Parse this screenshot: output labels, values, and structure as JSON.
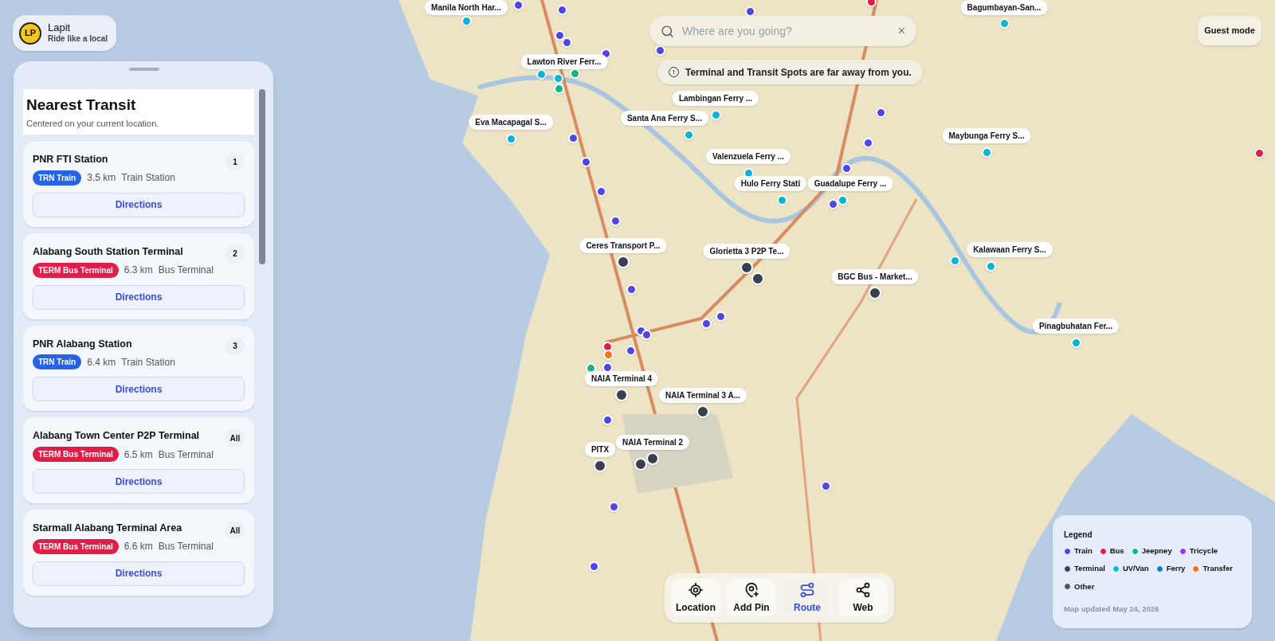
{
  "brand": {
    "initials": "LP",
    "name": "Lapit",
    "tagline": "Ride like a local"
  },
  "search": {
    "placeholder": "Where are you going?",
    "clear": "×"
  },
  "notice": {
    "icon": "!",
    "text": "Terminal and Transit Spots are far away from you."
  },
  "guest_button": "Guest mode",
  "panel": {
    "title": "Nearest Transit",
    "subtitle": "Centered on your current location.",
    "results": [
      {
        "name": "PNR FTI Station",
        "badge": {
          "kind": "train",
          "text": "TRN Train"
        },
        "distance": "3.5 km",
        "type": "Train Station",
        "rank": "1",
        "action": "Directions"
      },
      {
        "name": "Alabang South Station Terminal",
        "badge": {
          "kind": "terminal",
          "text": "TERM Bus Terminal"
        },
        "distance": "6.3 km",
        "type": "Bus Terminal",
        "rank": "2",
        "action": "Directions"
      },
      {
        "name": "PNR Alabang Station",
        "badge": {
          "kind": "train",
          "text": "TRN Train"
        },
        "distance": "6.4 km",
        "type": "Train Station",
        "rank": "3",
        "action": "Directions"
      },
      {
        "name": "Alabang Town Center P2P Terminal",
        "badge": {
          "kind": "terminal",
          "text": "TERM Bus Terminal"
        },
        "distance": "6.5 km",
        "type": "Bus Terminal",
        "rank": "All",
        "action": "Directions"
      },
      {
        "name": "Starmall Alabang Terminal Area",
        "badge": {
          "kind": "terminal",
          "text": "TERM Bus Terminal"
        },
        "distance": "6.6 km",
        "type": "Bus Terminal",
        "rank": "All",
        "action": "Directions"
      }
    ]
  },
  "markers": [
    {
      "kind": "ferry",
      "color": "#06b6d4",
      "label": "Manila North Har..."
    },
    {
      "kind": "ferry",
      "color": "#06b6d4",
      "label": "Lawton River Ferr..."
    },
    {
      "kind": "ferry",
      "color": "#06b6d4",
      "label": "Eva Macapagal S..."
    },
    {
      "kind": "ferry",
      "color": "#06b6d4",
      "label": "Lambingan Ferry ..."
    },
    {
      "kind": "ferry",
      "color": "#06b6d4",
      "label": "Santa Ana Ferry S..."
    },
    {
      "kind": "ferry",
      "color": "#06b6d4",
      "label": "Valenzuela Ferry ..."
    },
    {
      "kind": "ferry",
      "color": "#06b6d4",
      "label": "Hulo Ferry Stati"
    },
    {
      "kind": "ferry",
      "color": "#06b6d4",
      "label": "Guadalupe Ferry ..."
    },
    {
      "kind": "ferry",
      "color": "#06b6d4",
      "label": "Bagumbayan-San..."
    },
    {
      "kind": "ferry",
      "color": "#06b6d4",
      "label": "Maybunga Ferry S..."
    },
    {
      "kind": "ferry",
      "color": "#06b6d4",
      "label": "Kalawaan Ferry S..."
    },
    {
      "kind": "ferry",
      "color": "#06b6d4",
      "label": "Pinagbuhatan Fer..."
    },
    {
      "kind": "terminal",
      "color": "#374151",
      "label": "Ceres Transport P..."
    },
    {
      "kind": "terminal",
      "color": "#374151",
      "label": "Glorietta 3 P2P Te..."
    },
    {
      "kind": "terminal",
      "color": "#374151",
      "label": "BGC Bus - Market..."
    },
    {
      "kind": "terminal",
      "color": "#374151",
      "label": "NAIA Terminal 4"
    },
    {
      "kind": "terminal",
      "color": "#374151",
      "label": "NAIA Terminal 3 A..."
    },
    {
      "kind": "terminal",
      "color": "#374151",
      "label": "NAIA Terminal 2"
    },
    {
      "kind": "terminal",
      "color": "#374151",
      "label": "PITX"
    },
    {
      "kind": "terminal",
      "color": "#374151"
    },
    {
      "kind": "terminal",
      "color": "#374151"
    },
    {
      "kind": "ferry",
      "color": "#06b6d4"
    },
    {
      "kind": "ferry",
      "color": "#06b6d4"
    },
    {
      "kind": "train",
      "color": "#4f46e5"
    },
    {
      "kind": "train",
      "color": "#4f46e5"
    },
    {
      "kind": "train",
      "color": "#4f46e5"
    },
    {
      "kind": "train",
      "color": "#4f46e5"
    },
    {
      "kind": "train",
      "color": "#4f46e5"
    },
    {
      "kind": "train",
      "color": "#4f46e5"
    },
    {
      "kind": "train",
      "color": "#4f46e5"
    },
    {
      "kind": "train",
      "color": "#4f46e5"
    },
    {
      "kind": "train",
      "color": "#4f46e5"
    },
    {
      "kind": "train",
      "color": "#4f46e5"
    },
    {
      "kind": "train",
      "color": "#4f46e5"
    },
    {
      "kind": "train",
      "color": "#4f46e5"
    },
    {
      "kind": "train",
      "color": "#4f46e5"
    },
    {
      "kind": "train",
      "color": "#4f46e5"
    },
    {
      "kind": "train",
      "color": "#4f46e5"
    },
    {
      "kind": "train",
      "color": "#4f46e5"
    },
    {
      "kind": "train",
      "color": "#4f46e5"
    },
    {
      "kind": "train",
      "color": "#4f46e5"
    },
    {
      "kind": "train",
      "color": "#4f46e5"
    },
    {
      "kind": "train",
      "color": "#4f46e5"
    },
    {
      "kind": "train",
      "color": "#4f46e5"
    },
    {
      "kind": "train",
      "color": "#4f46e5"
    },
    {
      "kind": "train",
      "color": "#4f46e5"
    },
    {
      "kind": "train",
      "color": "#4f46e5"
    },
    {
      "kind": "train",
      "color": "#4f46e5"
    },
    {
      "kind": "train",
      "color": "#4f46e5"
    },
    {
      "kind": "bus",
      "color": "#e11d48"
    },
    {
      "kind": "bus",
      "color": "#e11d48"
    },
    {
      "kind": "bus",
      "color": "#e11d48"
    },
    {
      "kind": "jeepney",
      "color": "#10b981"
    },
    {
      "kind": "jeepney",
      "color": "#10b981"
    },
    {
      "kind": "jeepney",
      "color": "#10b981"
    },
    {
      "kind": "transfer",
      "color": "#f97316"
    }
  ],
  "toolbar": [
    {
      "kind": "location",
      "label": "Location",
      "selected": false
    },
    {
      "kind": "pin",
      "label": "Add Pin",
      "selected": false
    },
    {
      "kind": "route",
      "label": "Route",
      "selected": true
    },
    {
      "kind": "web",
      "label": "Web",
      "selected": false
    }
  ],
  "legend": {
    "title": "Legend",
    "items": [
      {
        "label": "Train",
        "color": "#4f46e5"
      },
      {
        "label": "Bus",
        "color": "#e11d48"
      },
      {
        "label": "Jeepney",
        "color": "#10b981"
      },
      {
        "label": "Tricycle",
        "color": "#9333ea"
      },
      {
        "label": "Terminal",
        "color": "#374151"
      },
      {
        "label": "UV/Van",
        "color": "#06b6d4"
      },
      {
        "label": "Ferry",
        "color": "#0284c7"
      },
      {
        "label": "Transfer",
        "color": "#f97316"
      },
      {
        "label": "Other",
        "color": "#4b5563"
      }
    ],
    "updated": "Map updated May 24, 2026"
  }
}
